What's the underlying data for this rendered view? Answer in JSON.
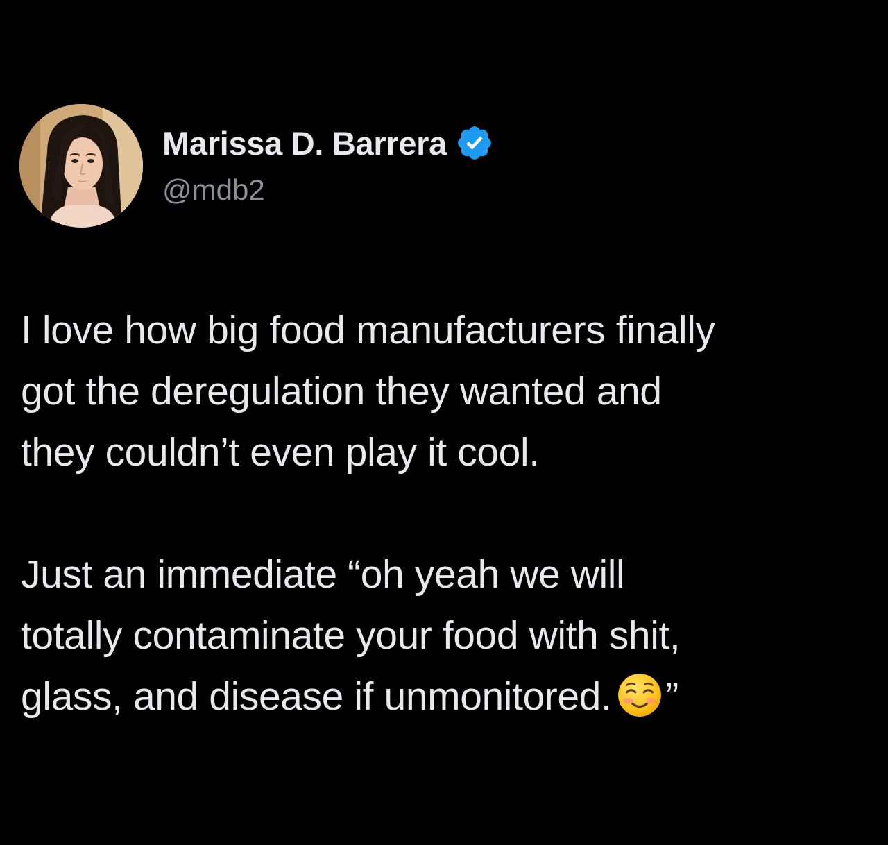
{
  "author": {
    "display_name": "Marissa D. Barrera",
    "handle": "@mdb2",
    "verified_icon": "verified-badge-icon",
    "colors": {
      "name": "#e7e9ea",
      "handle": "#8b9096",
      "verified": "#1d9bf0"
    }
  },
  "tweet": {
    "paragraph1": {
      "line1": "I love how big food manufacturers finally",
      "line2": "got the deregulation they wanted and",
      "line3": "they couldn’t even play it cool."
    },
    "paragraph2": {
      "line1": "Just an immediate “oh yeah we will",
      "line2": "totally contaminate your food with shit,",
      "line3_text": "glass, and disease if unmonitored.",
      "line3_emoji": "smiling-face-icon",
      "line3_close": "”"
    }
  },
  "theme": {
    "background": "#000000"
  }
}
